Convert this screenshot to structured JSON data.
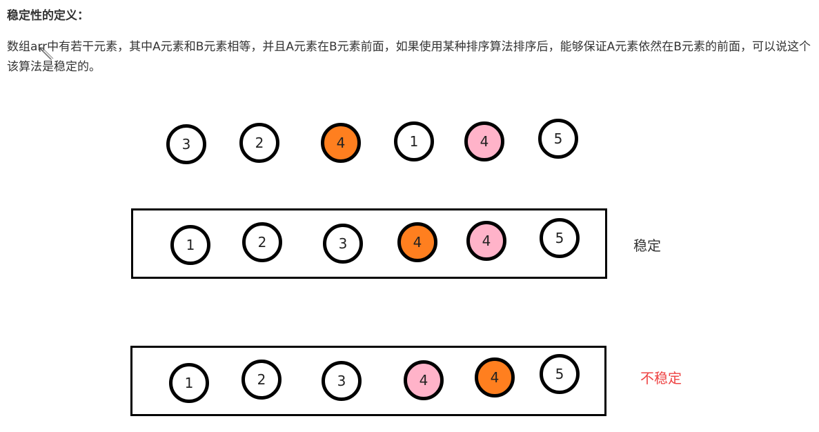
{
  "heading": "稳定性的定义：",
  "paragraph": "数组arr中有若干元素，其中A元素和B元素相等，并且A元素在B元素前面，如果使用某种排序算法排序后，能够保证A元素依然在B元素的前面，可以说这个该算法是稳定的。",
  "colors": {
    "plain": "#ffffff",
    "orange": "#ff7f1f",
    "pink": "#ffb3c9",
    "stable_label": "#333333",
    "unstable_label": "#ee4444"
  },
  "rows": {
    "original": {
      "label": "",
      "balls": [
        {
          "value": "3",
          "fill": "plain"
        },
        {
          "value": "2",
          "fill": "plain"
        },
        {
          "value": "4",
          "fill": "orange"
        },
        {
          "value": "1",
          "fill": "plain"
        },
        {
          "value": "4",
          "fill": "pink"
        },
        {
          "value": "5",
          "fill": "plain"
        }
      ]
    },
    "stable": {
      "label": "稳定",
      "balls": [
        {
          "value": "1",
          "fill": "plain"
        },
        {
          "value": "2",
          "fill": "plain"
        },
        {
          "value": "3",
          "fill": "plain"
        },
        {
          "value": "4",
          "fill": "orange"
        },
        {
          "value": "4",
          "fill": "pink"
        },
        {
          "value": "5",
          "fill": "plain"
        }
      ]
    },
    "unstable": {
      "label": "不稳定",
      "balls": [
        {
          "value": "1",
          "fill": "plain"
        },
        {
          "value": "2",
          "fill": "plain"
        },
        {
          "value": "3",
          "fill": "plain"
        },
        {
          "value": "4",
          "fill": "pink"
        },
        {
          "value": "4",
          "fill": "orange"
        },
        {
          "value": "5",
          "fill": "plain"
        }
      ]
    }
  }
}
